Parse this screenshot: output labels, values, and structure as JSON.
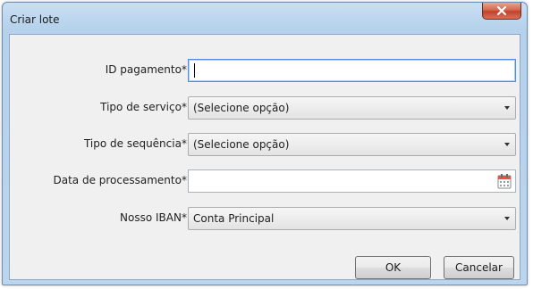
{
  "window": {
    "title": "Criar lote"
  },
  "form": {
    "payment_id": {
      "label": "ID pagamento*:",
      "value": ""
    },
    "service_type": {
      "label": "Tipo de serviço*:",
      "value": "(Selecione opção)"
    },
    "sequence_type": {
      "label": "Tipo de sequência*:",
      "value": "(Selecione opção)"
    },
    "processing_date": {
      "label": "Data de processamento*:",
      "value": ""
    },
    "our_iban": {
      "label": "Nosso IBAN*:",
      "value": "Conta Principal"
    }
  },
  "buttons": {
    "ok": "OK",
    "cancel": "Cancelar"
  },
  "icons": {
    "close": "close-icon",
    "calendar": "calendar-icon",
    "dropdown": "chevron-down-icon"
  },
  "colors": {
    "title_bar": "#b9d3ec",
    "close_button": "#c9472f",
    "focus_border": "#4d8fe0"
  }
}
